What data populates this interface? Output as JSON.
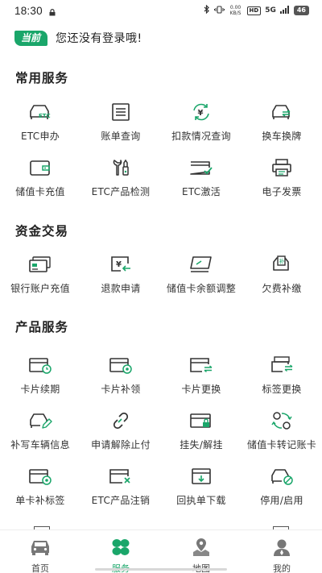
{
  "status_bar": {
    "time": "18:30",
    "network_speed": "0.00 KB/S",
    "hd": "HD",
    "signal": "5G",
    "battery": "46"
  },
  "login": {
    "badge": "当前",
    "text": "您还没有登录哦!"
  },
  "sections": [
    {
      "title": "常用服务",
      "items": [
        {
          "label": "ETC申办",
          "icon": "car-etc-icon"
        },
        {
          "label": "账单查询",
          "icon": "bill-icon"
        },
        {
          "label": "扣款情况查询",
          "icon": "yuan-refresh-icon"
        },
        {
          "label": "换车换牌",
          "icon": "car-swap-icon"
        },
        {
          "label": "储值卡充值",
          "icon": "wallet-icon"
        },
        {
          "label": "ETC产品检测",
          "icon": "tools-icon"
        },
        {
          "label": "ETC激活",
          "icon": "card-check-icon"
        },
        {
          "label": "电子发票",
          "icon": "printer-icon"
        }
      ]
    },
    {
      "title": "资金交易",
      "items": [
        {
          "label": "银行账户充值",
          "icon": "bank-card-icon"
        },
        {
          "label": "退款申请",
          "icon": "refund-icon"
        },
        {
          "label": "储值卡余额调整",
          "icon": "balance-adjust-icon"
        },
        {
          "label": "欠费补缴",
          "icon": "arrears-icon"
        }
      ]
    },
    {
      "title": "产品服务",
      "items": [
        {
          "label": "卡片续期",
          "icon": "card-clock-icon"
        },
        {
          "label": "卡片补领",
          "icon": "card-plus-icon"
        },
        {
          "label": "卡片更换",
          "icon": "card-swap-icon"
        },
        {
          "label": "标签更换",
          "icon": "tag-swap-icon"
        },
        {
          "label": "补写车辆信息",
          "icon": "car-edit-icon"
        },
        {
          "label": "申请解除止付",
          "icon": "unlink-icon"
        },
        {
          "label": "挂失/解挂",
          "icon": "card-lock-icon"
        },
        {
          "label": "储值卡转记账卡",
          "icon": "convert-icon"
        },
        {
          "label": "单卡补标签",
          "icon": "card-tag-icon"
        },
        {
          "label": "ETC产品注销",
          "icon": "card-cancel-icon"
        },
        {
          "label": "回执单下载",
          "icon": "download-icon"
        },
        {
          "label": "停用/启用",
          "icon": "car-disable-icon"
        }
      ]
    }
  ],
  "bottom_nav": [
    {
      "label": "首页",
      "icon": "car-home-icon",
      "active": false
    },
    {
      "label": "服务",
      "icon": "clover-icon",
      "active": true
    },
    {
      "label": "地图",
      "icon": "map-pin-icon",
      "active": false
    },
    {
      "label": "我的",
      "icon": "user-icon",
      "active": false
    }
  ],
  "colors": {
    "accent": "#1aa66a",
    "icon_dark": "#333333",
    "text": "#222222"
  }
}
